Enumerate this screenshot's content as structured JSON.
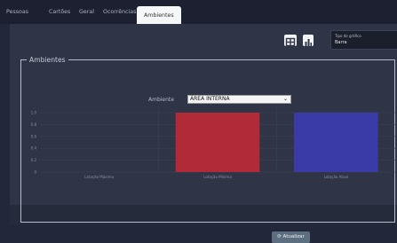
{
  "tabs": [
    {
      "label": "Pessoas",
      "active": false
    },
    {
      "label": "Cartões",
      "active": false
    },
    {
      "label": "Geral",
      "active": false
    },
    {
      "label": "Ocorrências",
      "active": false
    },
    {
      "label": "Ambientes",
      "active": true
    }
  ],
  "toolbar": {
    "table_icon": "table-icon",
    "chart_icon": "bar-chart-icon",
    "chart_type_label": "Tipo de gráfico",
    "chart_type_value": "Barra"
  },
  "section": {
    "legend": "Ambientes",
    "ambiente_label": "Ambiente",
    "ambiente_value": "ÁREA INTERNA"
  },
  "chart_data": {
    "type": "bar",
    "categories": [
      "Lotação Máxima",
      "Lotação Mínima",
      "Lotação Atual"
    ],
    "values": [
      0,
      1,
      1
    ],
    "colors": [
      "#6b6b6b",
      "#b02a37",
      "#3b3ba8"
    ],
    "ylim": [
      0,
      1.0
    ],
    "yticks": [
      "0",
      "0.2",
      "0.4",
      "0.6",
      "0.8",
      "1.0"
    ],
    "grid": true
  },
  "actions": {
    "refresh_label": "Atualizar",
    "refresh_icon": "refresh-icon"
  }
}
